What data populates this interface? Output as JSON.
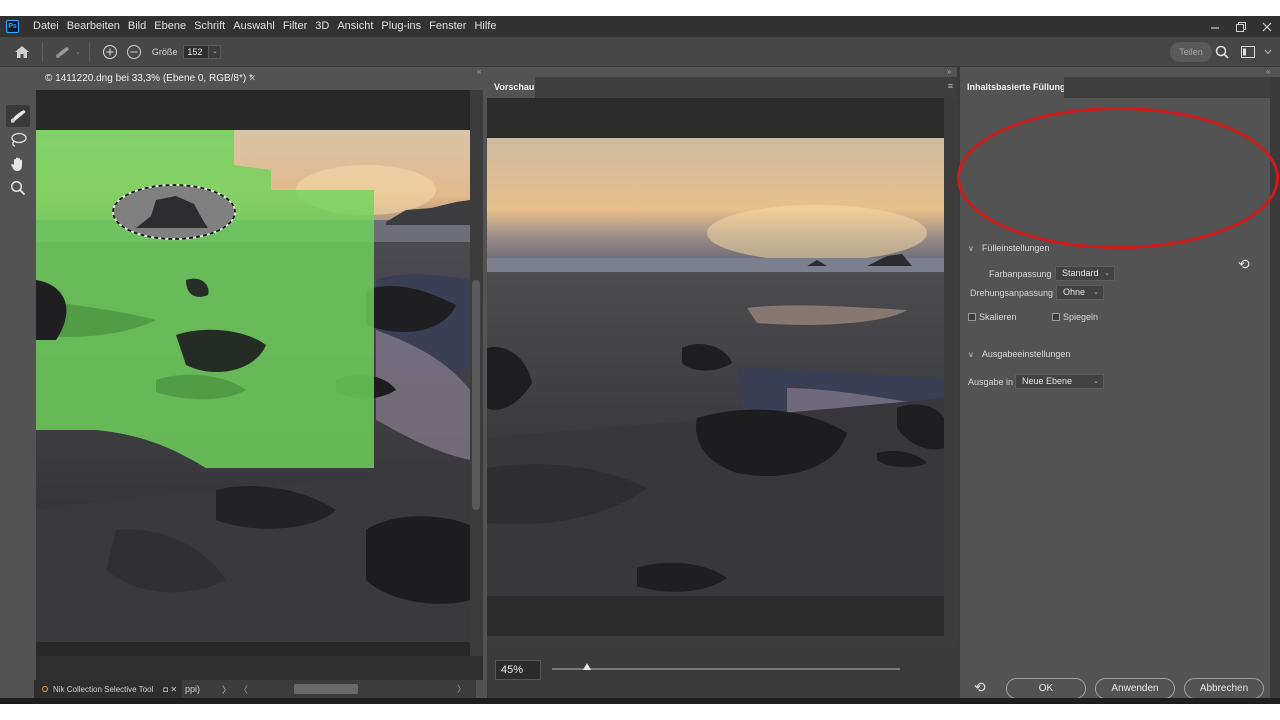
{
  "menubar": {
    "app_logo": "Ps",
    "items": [
      "Datei",
      "Bearbeiten",
      "Bild",
      "Ebene",
      "Schrift",
      "Auswahl",
      "Filter",
      "3D",
      "Ansicht",
      "Plug-ins",
      "Fenster",
      "Hilfe"
    ]
  },
  "options_bar": {
    "size_label": "Größe",
    "size_value": "152",
    "share_label": "Teilen"
  },
  "document": {
    "tab_title": "© 1411220.dng bei 33,3% (Ebene 0, RGB/8*) *",
    "status_text": "ppi)",
    "status_nav": "〉",
    "status_nav_left": "〈",
    "status_nav_right": "〉"
  },
  "nik": {
    "label": "Nik Collection Selective Tool",
    "controls": "◘ ✕"
  },
  "preview": {
    "tab_label": "Vorschau",
    "zoom_value": "45%",
    "zoom_fraction": 0.1
  },
  "panel": {
    "tab_label": "Inhaltsbasierte Füllung",
    "fill_section": "Fülleinstellungen",
    "color_adapt_label": "Farbanpassung",
    "color_adapt_value": "Standard",
    "rotation_adapt_label": "Drehungsanpassung",
    "rotation_adapt_value": "Ohne",
    "scale_label": "Skalieren",
    "mirror_label": "Spiegeln",
    "output_section": "Ausgabeeinstellungen",
    "output_label": "Ausgabe in",
    "output_value": "Neue Ebene",
    "ok_label": "OK",
    "apply_label": "Anwenden",
    "cancel_label": "Abbrechen"
  },
  "colors": {
    "annotation_red": "#d11a1a",
    "mask_green": "#6fd45a",
    "app_bg": "#535353"
  },
  "icons": {
    "home": "home-icon",
    "brush": "healing-brush-icon",
    "add": "add-to-selection-icon",
    "subtract": "subtract-from-selection-icon",
    "search": "search-icon",
    "workspace": "workspace-icon",
    "lasso": "lasso-icon",
    "hand": "hand-icon",
    "zoom": "zoom-icon",
    "reset": "reset-icon"
  }
}
